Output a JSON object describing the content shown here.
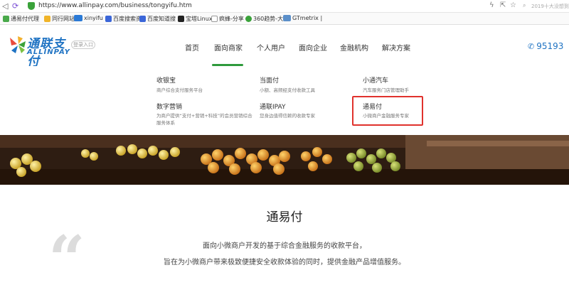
{
  "browser": {
    "url": "https://www.allinpay.com/business/tongyifu.htm",
    "search_placeholder": "2019十大没想到",
    "bookmarks": [
      "通易付代理",
      "同行网站",
      "xinyifu",
      "百度搜索资",
      "百度知道搜",
      "宝塔Linux",
      "疯蜂-分享",
      "360趋势-大",
      "GTmetrix |"
    ]
  },
  "site": {
    "logo_cn": "通联支付",
    "logo_en": "ALLINPAY",
    "login_label": "登录入口",
    "nav": [
      "首页",
      "面向商家",
      "个人用户",
      "面向企业",
      "金融机构",
      "解决方案"
    ],
    "active_nav": "面向商家",
    "hotline": "95193",
    "colors": {
      "brand": "#1f73c3",
      "nav_active": "#2f9a3c",
      "highlight": "#e0322d"
    }
  },
  "dropdown": {
    "items": [
      {
        "title": "收银宝",
        "desc": "商户综合支付服务平台"
      },
      {
        "title": "当面付",
        "desc": "小额、高频经支付收款工具"
      },
      {
        "title": "小通汽车",
        "desc": "汽车服务门店管理助手"
      },
      {
        "title": "数字营销",
        "desc": "为商户提供“支付+营销+科技”的会员营销综合",
        "desc2": "服务体系"
      },
      {
        "title": "通联IPAY",
        "desc": "您身边值得信赖的收款专家"
      },
      {
        "title": "通易付",
        "desc": "小微商户金融服务专家"
      }
    ]
  },
  "content": {
    "title": "通易付",
    "quote_glyph": "“",
    "line1": "面向小微商户开发的基于综合金融服务的收款平台，",
    "line2": "旨在为小微商户带来极致便捷安全收款体验的同时，提供金融产品增值服务。"
  }
}
